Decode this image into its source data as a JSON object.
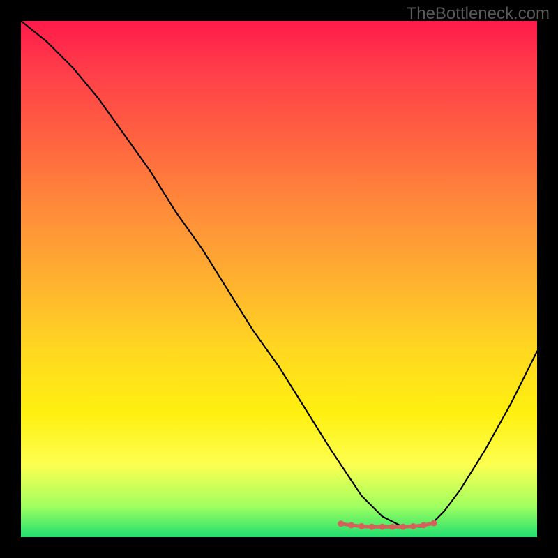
{
  "watermark": "TheBottleneck.com",
  "chart_data": {
    "type": "line",
    "title": "",
    "xlabel": "",
    "ylabel": "",
    "xlim": [
      0,
      100
    ],
    "ylim": [
      0,
      100
    ],
    "series": [
      {
        "name": "curve",
        "x": [
          0,
          5,
          10,
          15,
          20,
          25,
          30,
          35,
          40,
          45,
          50,
          55,
          60,
          62,
          64,
          66,
          68,
          70,
          72,
          74,
          76,
          78,
          80,
          82,
          85,
          90,
          95,
          100
        ],
        "y": [
          100,
          96,
          91,
          85,
          78,
          71,
          63,
          56,
          48,
          40,
          33,
          25,
          17,
          14,
          11,
          8,
          6,
          4,
          3,
          2,
          2,
          2,
          3,
          5,
          9,
          17,
          26,
          36
        ]
      }
    ],
    "markers": {
      "name": "bottom-markers",
      "color": "#d6605c",
      "x": [
        62,
        64,
        66,
        68,
        70,
        72,
        74,
        76,
        78,
        80
      ],
      "y": [
        2.6,
        2.3,
        2.1,
        2.0,
        2.0,
        2.0,
        2.0,
        2.1,
        2.3,
        2.7
      ]
    }
  }
}
